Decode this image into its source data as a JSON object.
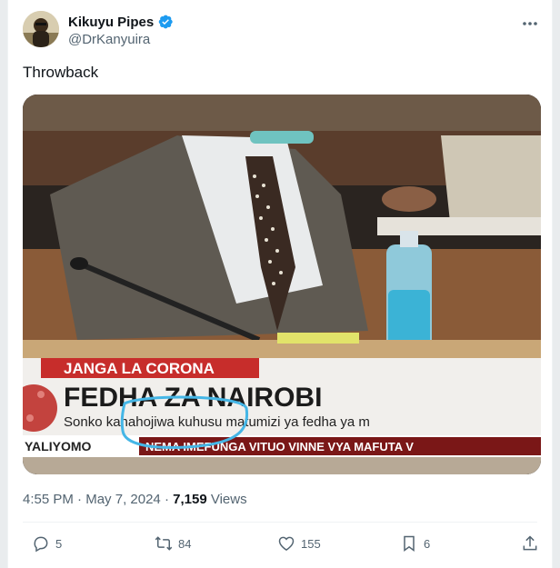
{
  "tweet": {
    "author": {
      "display_name": "Kikuyu Pipes",
      "handle": "@DrKanyuira",
      "verified": true
    },
    "text": "Throwback",
    "image": {
      "banner_label": "JANGA LA CORONA",
      "headline": "FEDHA ZA NAIROBI",
      "subline": "Sonko kanahojiwa kuhusu matumizi ya fedha  ya m",
      "ticker_left": "YALIYOMO",
      "ticker_right": "NEMA IMEFUNGA VITUO VINNE VYA MAFUTA V"
    },
    "meta": {
      "time": "4:55 PM",
      "sep1": "·",
      "date": "May 7, 2024",
      "sep2": "·",
      "views_count": "7,159",
      "views_label": "Views"
    },
    "actions": {
      "replies": "5",
      "retweets": "84",
      "likes": "155",
      "bookmarks": "6"
    }
  },
  "colors": {
    "verified": "#1d9bf0",
    "muted": "#536471",
    "text": "#0f1419"
  }
}
